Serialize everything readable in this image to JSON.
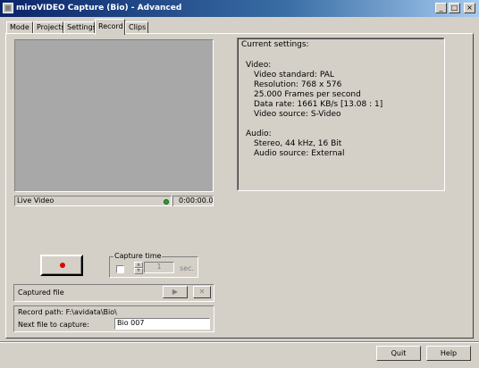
{
  "window": {
    "title": "miroVIDEO Capture (Bio) - Advanced",
    "minimize": "_",
    "maximize": "□",
    "close": "×"
  },
  "tabs": [
    {
      "label": "Mode"
    },
    {
      "label": "Projects"
    },
    {
      "label": "Settings"
    },
    {
      "label": "Record"
    },
    {
      "label": "Clips"
    }
  ],
  "preview": {
    "status_label": "Live Video",
    "timecode": "0:00:00.00"
  },
  "settings": {
    "heading": "Current settings:",
    "video_heading": "Video:",
    "video_lines": [
      "Video standard: PAL",
      "Resolution: 768 x 576",
      "25.000 Frames per second",
      "Data rate: 1661 KB/s [13.08 : 1]",
      "Video source: S-Video"
    ],
    "audio_heading": "Audio:",
    "audio_lines": [
      "Stereo, 44 kHz, 16 Bit",
      "Audio source: External"
    ]
  },
  "capture_time": {
    "legend": "Capture time",
    "value": "1",
    "unit": "sec."
  },
  "captured_file": {
    "label": "Captured file",
    "play_icon": "▶",
    "delete_icon": "✕"
  },
  "record_path": {
    "path_label": "Record path: F:\\avidata\\Bio\\",
    "next_file_label": "Next file to capture:",
    "next_file_value": "Bio 007"
  },
  "footer": {
    "quit_label": "Quit",
    "help_label": "Help"
  }
}
